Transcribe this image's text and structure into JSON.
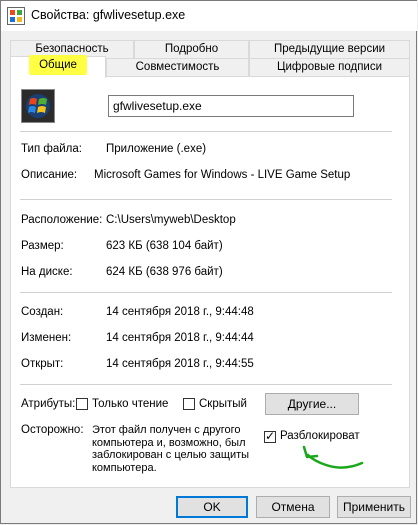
{
  "window": {
    "title": "Свойства: gfwlivesetup.exe"
  },
  "tabs": {
    "row1": [
      "Безопасность",
      "Подробно",
      "Предыдущие версии"
    ],
    "row2": [
      "Общие",
      "Совместимость",
      "Цифровые подписи"
    ]
  },
  "general": {
    "filename": "gfwlivesetup.exe",
    "type_label": "Тип файла:",
    "type_value": "Приложение (.exe)",
    "desc_label": "Описание:",
    "desc_value": "Microsoft Games for Windows - LIVE Game Setup",
    "location_label": "Расположение:",
    "location_value": "C:\\Users\\myweb\\Desktop",
    "size_label": "Размер:",
    "size_value": "623 КБ (638 104 байт)",
    "disk_label": "На диске:",
    "disk_value": "624 КБ (638 976 байт)",
    "created_label": "Создан:",
    "created_value": "14 сентября 2018 г., 9:44:48",
    "modified_label": "Изменен:",
    "modified_value": "14 сентября 2018 г., 9:44:44",
    "opened_label": "Открыт:",
    "opened_value": "14 сентября 2018 г., 9:44:55",
    "attributes_label": "Атрибуты:",
    "readonly_label": "Только чтение",
    "hidden_label": "Скрытый",
    "other_button": "Другие...",
    "caution_label": "Осторожно:",
    "caution_text": "Этот файл получен с другого компьютера и, возможно, был заблокирован с целью защиты компьютера.",
    "unblock_label": "Разблокировать",
    "unblock_checked": true,
    "readonly_checked": false,
    "hidden_checked": false
  },
  "buttons": {
    "ok": "OK",
    "cancel": "Отмена",
    "apply": "Применить"
  },
  "colors": {
    "highlight": "#ffff44",
    "annotation": "#1aa81a",
    "default_border": "#0078d7"
  }
}
